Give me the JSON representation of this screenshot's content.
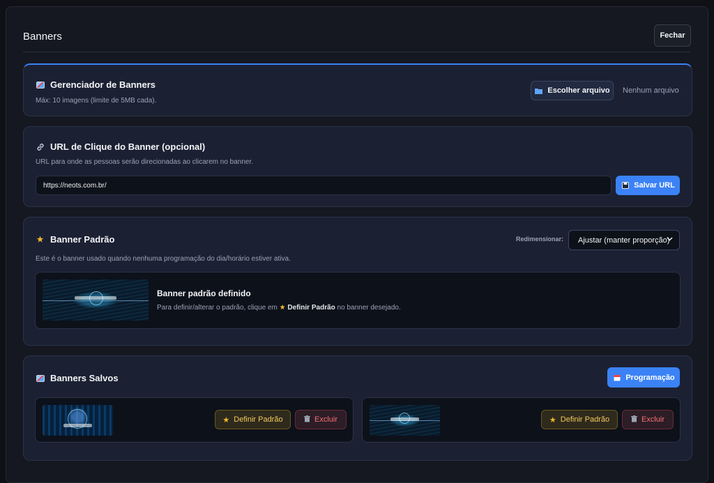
{
  "modal": {
    "title": "Banners",
    "close_label": "Fechar"
  },
  "manager": {
    "title": "Gerenciador de Banners",
    "icon": "image-icon",
    "description": "Máx: 10 imagens (limite de 5MB cada).",
    "choose_file_label": "Escolher arquivo",
    "choose_file_icon": "folder-icon",
    "no_file_text": "Nenhum arquivo"
  },
  "click_url": {
    "title": "URL de Clique do Banner (opcional)",
    "icon": "link-icon",
    "description": "URL para onde as pessoas serão direcionadas ao clicarem no banner.",
    "url_value": "https://neots.com.br/",
    "save_label": "Salvar URL",
    "save_icon": "floppy-disk-icon"
  },
  "default_banner": {
    "title": "Banner Padrão",
    "icon": "star-icon",
    "resize_label": "Redimensionar:",
    "resize_value": "Ajustar (manter proporção)",
    "description": "Este é o banner usado quando nenhuma programação do dia/horário estiver ativa.",
    "defined_title": "Banner padrão definido",
    "help_prefix": "Para definir/alterar o padrão, clique em",
    "help_action": "Definir Padrão",
    "help_suffix": "no banner desejado."
  },
  "saved": {
    "title": "Banners Salvos",
    "icon": "image-icon",
    "schedule_label": "Programação",
    "schedule_icon": "calendar-icon",
    "items": [
      {
        "set_default_label": "Definir Padrão",
        "delete_label": "Excluir"
      },
      {
        "set_default_label": "Definir Padrão",
        "delete_label": "Excluir"
      }
    ]
  },
  "colors": {
    "accent": "#3b82f6",
    "gold": "#f3c95a",
    "danger": "#f87171",
    "panel": "#1b2133"
  }
}
